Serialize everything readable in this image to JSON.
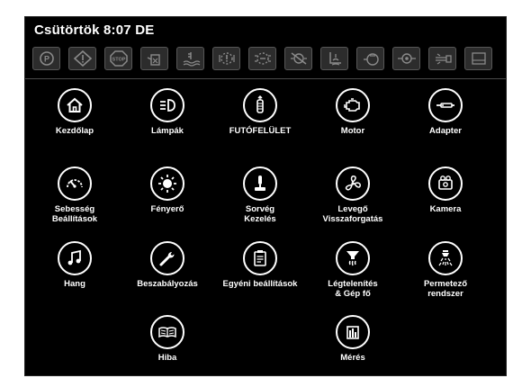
{
  "status": {
    "clock": "Csütörtök 8:07 DE"
  },
  "warning_icons": [
    "parking-brake-icon",
    "warning-icon",
    "stop-icon",
    "hydraulic-oil-icon",
    "engine-coolant-icon",
    "transmission-warning-icon",
    "transmission-fault-icon",
    "hydraulic-fault-icon",
    "def-level-icon",
    "air-filter-icon",
    "oil-pressure-icon",
    "cleaner-icon",
    "ceiling-panel-icon"
  ],
  "menu": {
    "home": "Kezdőlap",
    "lights": "Lámpák",
    "tread": "FUTÓFELÜLET",
    "engine": "Motor",
    "adapter": "Adapter",
    "speed_settings": "Sebesség\nBeállítások",
    "brightness": "Fényerő",
    "row_control": "Sorvég\nKezelés",
    "air_recirc": "Levegő\nVisszaforgatás",
    "camera": "Kamera",
    "sound": "Hang",
    "adjustment": "Beszabályozás",
    "custom_settings": "Egyéni beállítások",
    "ventilation": "Légtelenítés\n& Gép fő",
    "sprayer": "Permetező\nrendszer",
    "error": "Hiba",
    "measurement": "Mérés"
  }
}
